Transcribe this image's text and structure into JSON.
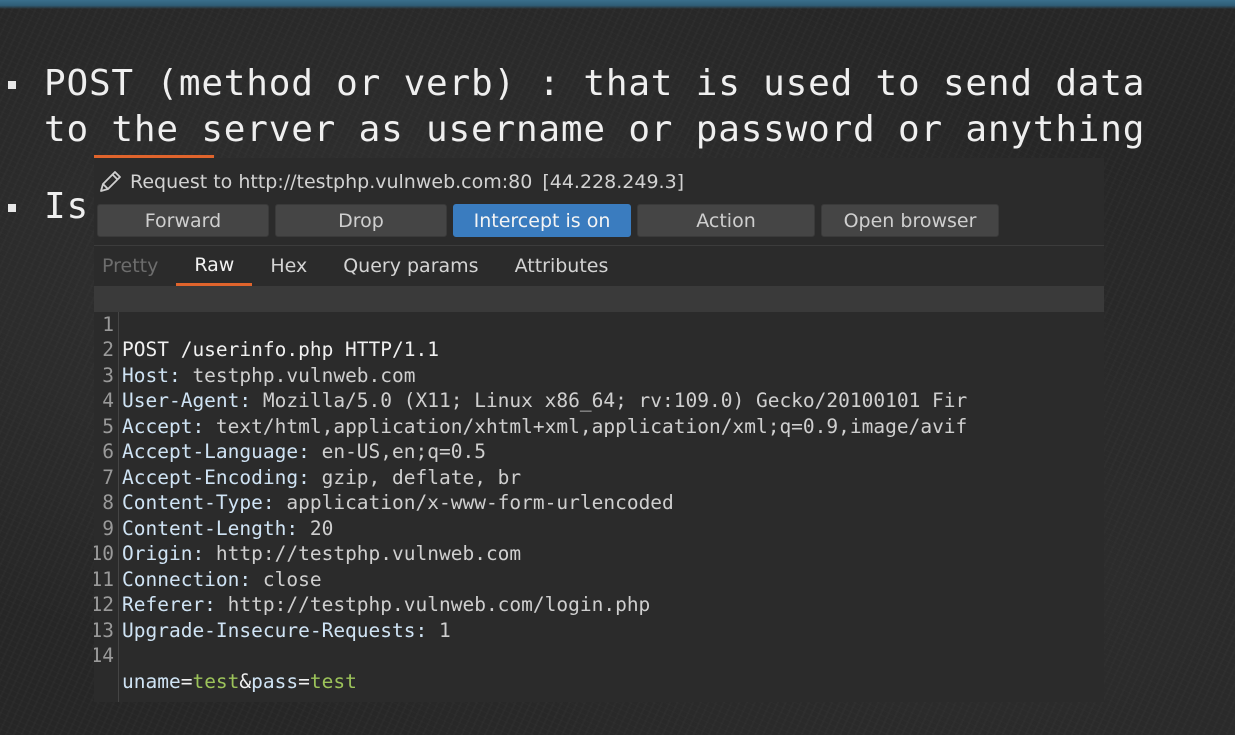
{
  "slide": {
    "bullet1_line1": "POST (method or verb) : that is used to send data",
    "bullet1_line2": "to the server as username or password or anything",
    "bullet2_text": "Is"
  },
  "burp": {
    "request_title": "Request to http://testphp.vulnweb.com:80",
    "request_ip": "[44.228.249.3]",
    "buttons": {
      "forward": "Forward",
      "drop": "Drop",
      "intercept": "Intercept is on",
      "action": "Action",
      "open_browser": "Open browser"
    },
    "tabs": {
      "pretty": "Pretty",
      "raw": "Raw",
      "hex": "Hex",
      "query_params": "Query params",
      "attributes": "Attributes"
    },
    "colors": {
      "accent": "#e0642c",
      "intercept_on": "#3a7cbf",
      "param_value": "#9cc35a"
    },
    "icons": {
      "edit": "pencil-icon"
    },
    "request_line": "POST /userinfo.php HTTP/1.1",
    "headers": [
      {
        "line": "2",
        "key": "Host:",
        "value": " testphp.vulnweb.com"
      },
      {
        "line": "3",
        "key": "User-Agent:",
        "value": " Mozilla/5.0 (X11; Linux x86_64; rv:109.0) Gecko/20100101 Fir"
      },
      {
        "line": "4",
        "key": "Accept:",
        "value": " text/html,application/xhtml+xml,application/xml;q=0.9,image/avif"
      },
      {
        "line": "5",
        "key": "Accept-Language:",
        "value": " en-US,en;q=0.5"
      },
      {
        "line": "6",
        "key": "Accept-Encoding:",
        "value": " gzip, deflate, br"
      },
      {
        "line": "7",
        "key": "Content-Type:",
        "value": " application/x-www-form-urlencoded"
      },
      {
        "line": "8",
        "key": "Content-Length:",
        "value": " 20"
      },
      {
        "line": "9",
        "key": "Origin:",
        "value": " http://testphp.vulnweb.com"
      },
      {
        "line": "10",
        "key": "Connection:",
        "value": " close"
      },
      {
        "line": "11",
        "key": "Referer:",
        "value": " http://testphp.vulnweb.com/login.php"
      },
      {
        "line": "12",
        "key": "Upgrade-Insecure-Requests:",
        "value": " 1"
      }
    ],
    "body": {
      "key1": "uname",
      "eq1": "=",
      "val1": "test",
      "amp": "&",
      "key2": "pass",
      "eq2": "=",
      "val2": "test"
    },
    "line_numbers": [
      "1",
      "13",
      "14"
    ]
  }
}
